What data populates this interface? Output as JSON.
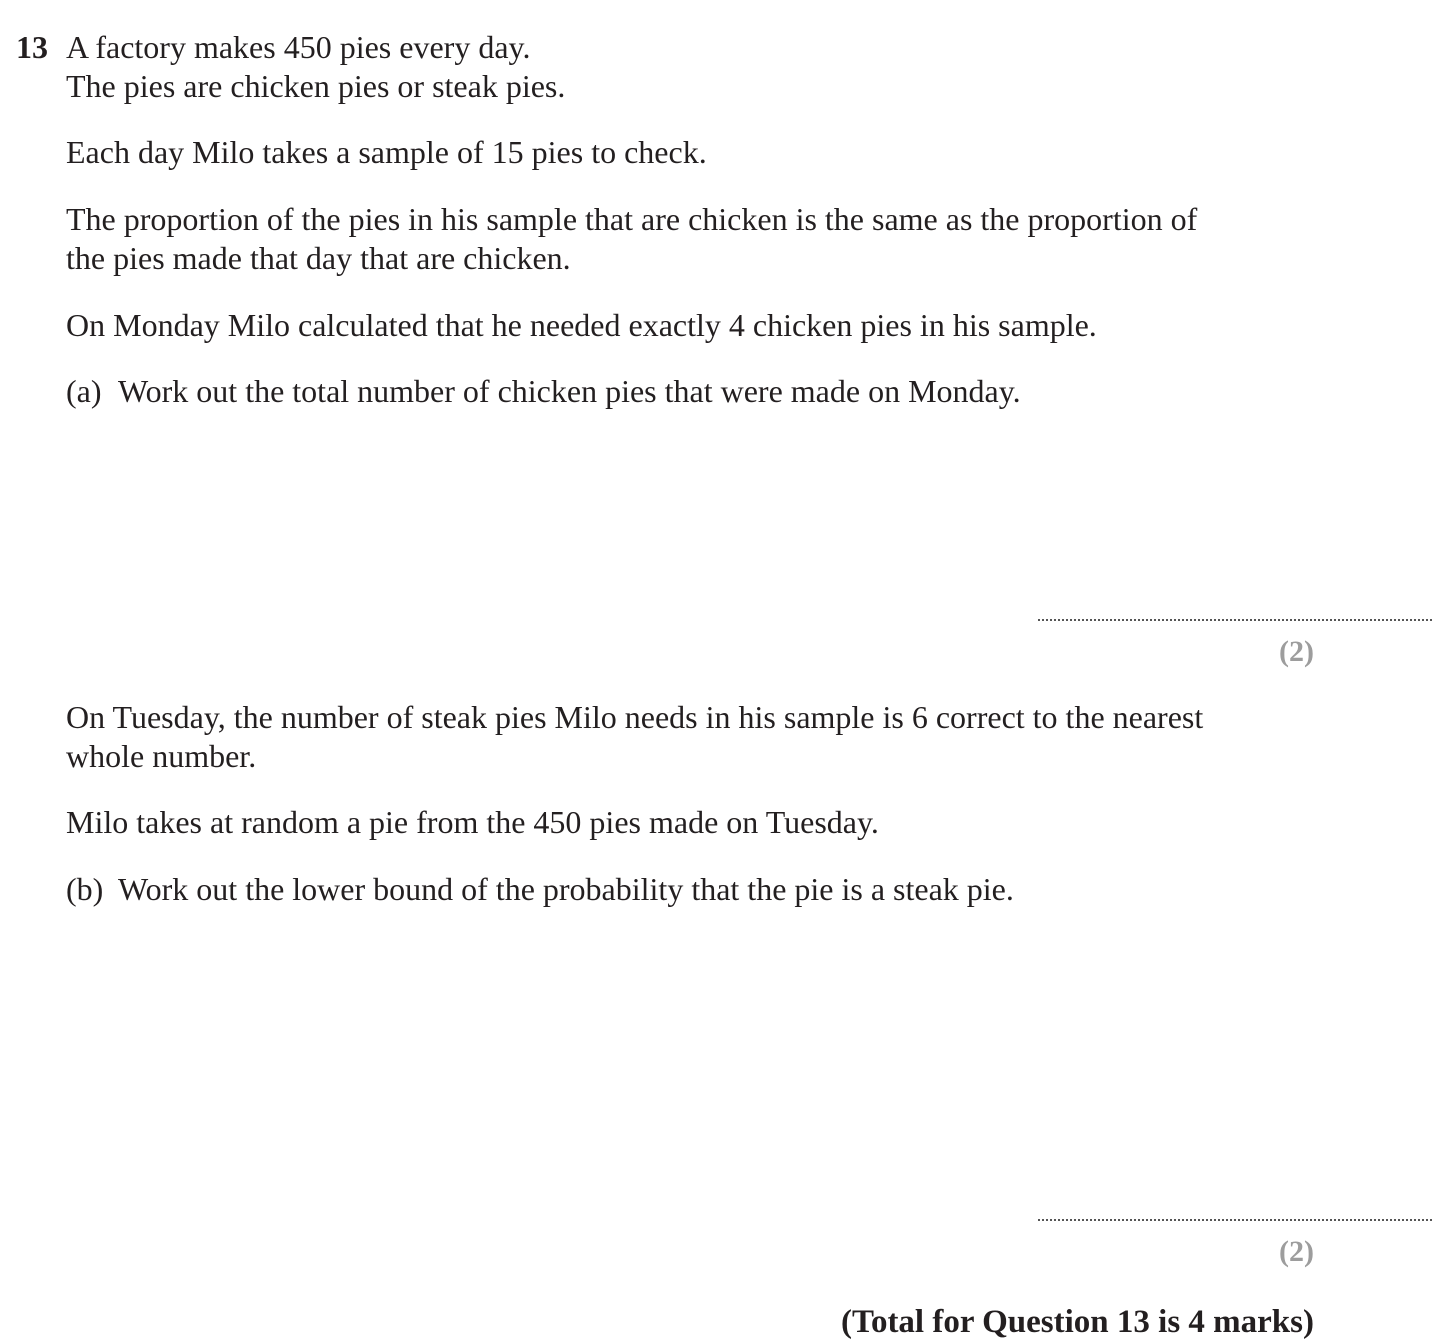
{
  "question": {
    "number": "13",
    "intro": [
      "A factory makes 450 pies every day.",
      "The pies are chicken pies or steak pies.",
      "Each day Milo takes a sample of 15 pies to check.",
      "The proportion of the pies in his sample that are chicken is the same as the proportion of",
      "the pies made that day that are chicken.",
      "On Monday Milo calculated that he needed exactly 4 chicken pies in his sample."
    ],
    "part_a": {
      "label": "(a)",
      "text": "Work out the total number of chicken pies that were made on Monday.",
      "marks": "(2)"
    },
    "part_b_intro": [
      "On Tuesday, the number of steak pies Milo needs in his sample is 6 correct to the nearest",
      "whole number.",
      "Milo takes at random a pie from the 450 pies made on Tuesday."
    ],
    "part_b": {
      "label": "(b)",
      "text": "Work out the lower bound of the probability that the pie is a steak pie.",
      "marks": "(2)"
    },
    "total": "(Total for Question 13 is 4 marks)"
  }
}
